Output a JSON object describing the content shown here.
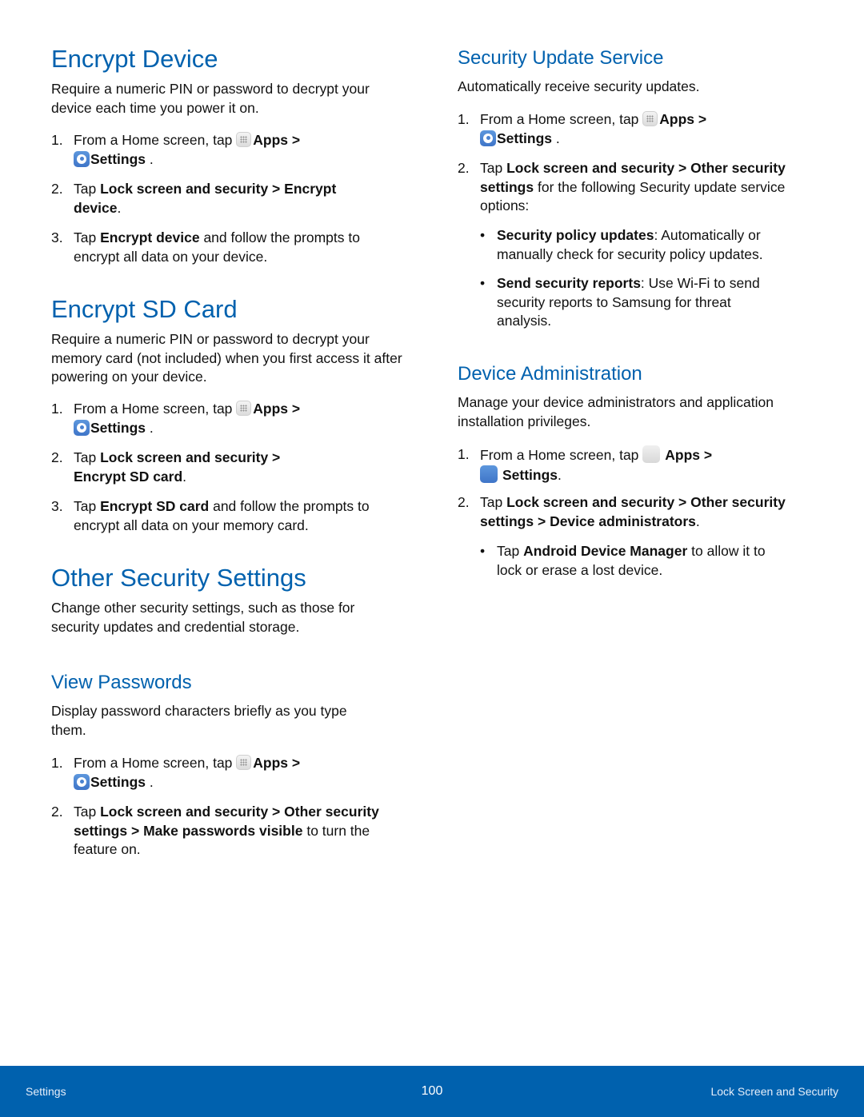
{
  "left": {
    "encrypt_device": {
      "title": "Encrypt Device",
      "intro": "Require a numeric PIN or password to decrypt your device each time you power it on.",
      "steps": [
        {
          "num": "1.",
          "pre": "From a Home screen, tap ",
          "apps": "Apps",
          "sep": " >",
          "settings": "Settings",
          "post": " ."
        },
        {
          "num": "2.",
          "pre": "Tap ",
          "b1": "Lock screen and security",
          "mid": " > ",
          "b2": "Encrypt device",
          "post": "."
        },
        {
          "num": "3.",
          "pre": "Tap ",
          "b1": "Encrypt device",
          "post": " and follow the prompts to encrypt all data on your device."
        }
      ]
    },
    "encrypt_sd": {
      "title": "Encrypt SD Card",
      "intro": "Require a numeric PIN or password to decrypt your memory card (not included) when you first access it after powering on your device.",
      "steps": [
        {
          "num": "1.",
          "pre": "From a Home screen, tap ",
          "apps": "Apps",
          "sep": " >",
          "settings": "Settings",
          "post": " ."
        },
        {
          "num": "2.",
          "pre": "Tap ",
          "b1": "Lock screen and security",
          "mid": " > ",
          "b2": "Encrypt SD card",
          "post": "."
        },
        {
          "num": "3.",
          "pre": "Tap ",
          "b1": "Encrypt SD card",
          "post": " and follow the prompts to encrypt all data on your memory card."
        }
      ]
    },
    "other_security": {
      "title": "Other Security Settings",
      "intro": "Change other security settings, such as those for security updates and credential storage."
    },
    "view_passwords": {
      "title": "View Passwords",
      "intro": "Display password characters briefly as you type them.",
      "steps": [
        {
          "num": "1.",
          "pre": "From a Home screen, tap ",
          "apps": "Apps",
          "sep": " >",
          "settings": "Settings",
          "post": " ."
        },
        {
          "num": "2.",
          "pre": "Tap ",
          "b1": "Lock screen and security",
          "mid": " > ",
          "b2": "Other security settings",
          "mid2": " > ",
          "b3": "Make passwords visible",
          "post": " to turn the feature on."
        }
      ]
    }
  },
  "right": {
    "security_update": {
      "title": "Security Update Service",
      "intro": "Automatically receive security updates.",
      "steps": [
        {
          "num": "1.",
          "pre": "From a Home screen, tap ",
          "apps": "Apps",
          "sep": " >",
          "settings": "Settings",
          "post": " ."
        },
        {
          "num": "2.",
          "pre": "Tap ",
          "b1": "Lock screen and security",
          "mid": " > ",
          "b2": "Other security settings",
          "post": " for the following Security update service options:"
        }
      ],
      "bullets": [
        {
          "bold": "Security policy updates",
          "text": ": Automatically or manually check for security policy updates."
        },
        {
          "bold": "Send security reports",
          "text": ": Use Wi-Fi to send security reports to Samsung for threat analysis."
        }
      ]
    },
    "device_admin": {
      "title": "Device Administration",
      "intro": "Manage your device administrators and application installation privileges.",
      "steps": [
        {
          "num": "1.",
          "pre": "From a Home screen, tap ",
          "apps": "Apps",
          "sep": " >",
          "settings": "Settings",
          "post": "."
        },
        {
          "num": "2.",
          "pre": "Tap ",
          "b1": "Lock screen and security",
          "mid": " > ",
          "b2": "Other security settings",
          "mid2": " > ",
          "b3": "Device administrators",
          "post": "."
        }
      ],
      "bullets": [
        {
          "pre": "Tap ",
          "bold": "Android Device Manager",
          "text": " to allow it to lock or erase a lost device."
        }
      ]
    }
  },
  "icons": {
    "apps": "apps-grid-icon",
    "settings": "settings-gear-icon",
    "bullet": "•"
  },
  "footer": {
    "left": "Settings",
    "page": "100",
    "right": "Lock Screen and Security",
    "color": "#0061ae"
  },
  "colors": {
    "heading": "#0061ae",
    "body": "#111111"
  }
}
